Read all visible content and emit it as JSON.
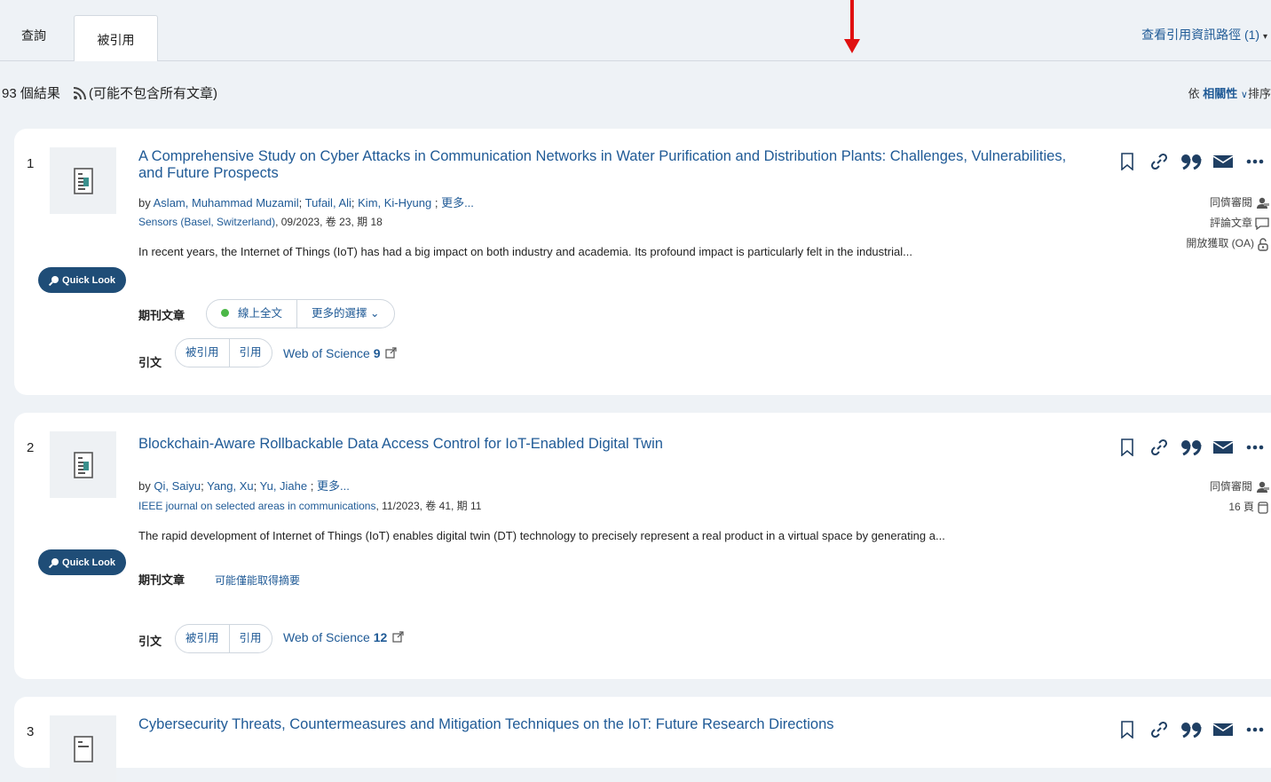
{
  "tabs": {
    "search": "查詢",
    "cited": "被引用"
  },
  "citation_path": {
    "label": "查看引用資訊路徑 (1)",
    "caret": "▾"
  },
  "results": {
    "count_text": "93 個結果",
    "note": "(可能不包含所有文章)"
  },
  "sort": {
    "prefix": "依",
    "value": "相關性",
    "caret": "∨",
    "suffix": "排序"
  },
  "common": {
    "quick_look": "Quick Look",
    "by": "by",
    "more": "更多...",
    "journal_article": "期刊文章",
    "online_fulltext": "線上全文",
    "more_options": "更多的選擇",
    "more_options_caret": "⌄",
    "citations": "引文",
    "cited_by": "被引用",
    "references": "引用",
    "wos": "Web of Science",
    "peer_reviewed": "同儕審閱",
    "abstract_only": "可能僅能取得摘要"
  },
  "icons": [
    "bookmark-icon",
    "link-icon",
    "quote-icon",
    "email-icon",
    "more-icon",
    "rss-icon",
    "document-icon",
    "search-icon",
    "external-link-icon",
    "peer-review-icon",
    "comment-icon",
    "open-access-icon",
    "pages-icon"
  ],
  "colors": {
    "link": "#1f5a96",
    "quick_look_bg": "#1f4d77",
    "online_dot": "#4cb848",
    "arrow": "#e01010",
    "page_bg": "#eef2f6"
  },
  "items": [
    {
      "num": "1",
      "title": "A Comprehensive Study on Cyber Attacks in Communication Networks in Water Purification and Distribution Plants: Challenges, Vulnerabilities, and Future Prospects",
      "authors": [
        "Aslam, Muhammad Muzamil",
        "Tufail, Ali",
        "Kim, Ki-Hyung"
      ],
      "source": "Sensors (Basel, Switzerland)",
      "source_meta": ", 09/2023, 卷 23, 期 18",
      "abstract": "In recent years, the Internet of Things (IoT) has had a big impact on both industry and academia. Its profound impact is particularly felt in the industrial...",
      "wos_count": "9",
      "meta": [
        "同儕審閱",
        "評論文章",
        "開放獲取 (OA)"
      ]
    },
    {
      "num": "2",
      "title": "Blockchain-Aware Rollbackable Data Access Control for IoT-Enabled Digital Twin",
      "authors": [
        "Qi, Saiyu",
        "Yang, Xu",
        "Yu, Jiahe"
      ],
      "source": "IEEE journal on selected areas in communications",
      "source_meta": ", 11/2023, 卷 41, 期 11",
      "abstract": "The rapid development of Internet of Things (IoT) enables digital twin (DT) technology to precisely represent a real product in a virtual space by generating a...",
      "wos_count": "12",
      "meta": [
        "同儕審閱",
        "16 頁"
      ]
    },
    {
      "num": "3",
      "title": "Cybersecurity Threats, Countermeasures and Mitigation Techniques on the IoT: Future Research Directions"
    }
  ]
}
